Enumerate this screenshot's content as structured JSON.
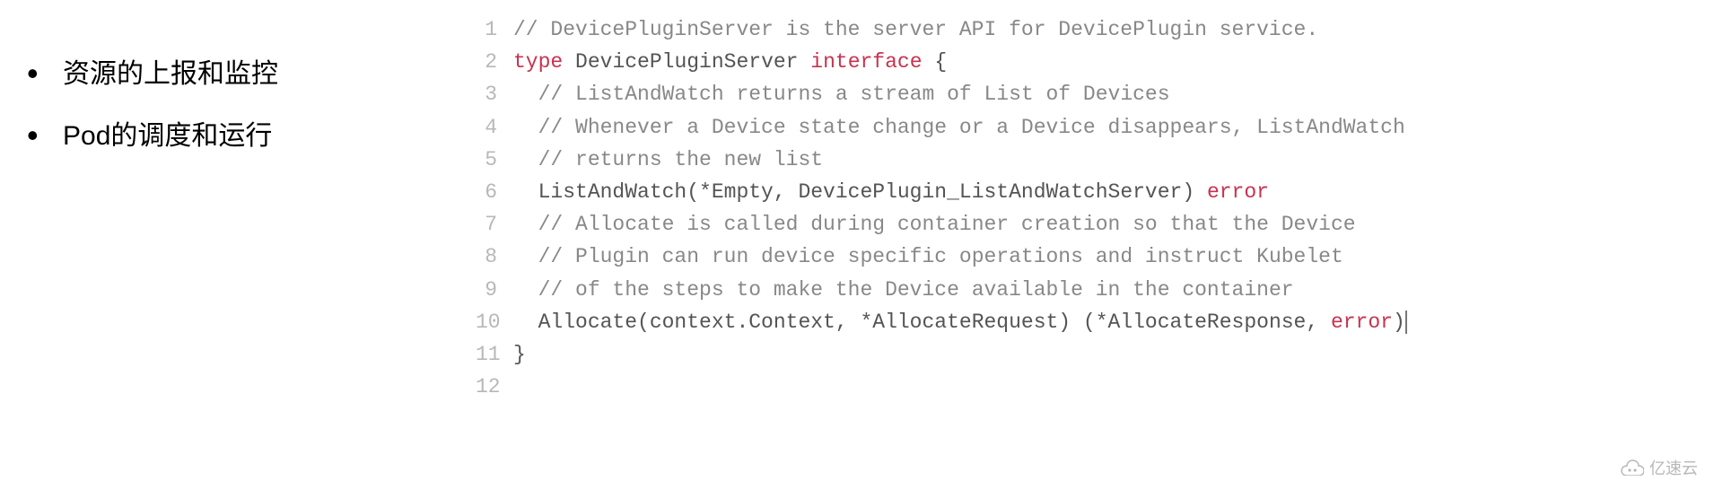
{
  "left": {
    "bullets": [
      "资源的上报和监控",
      "Pod的调度和运行"
    ]
  },
  "code": {
    "lines": [
      {
        "n": "1",
        "segments": [
          {
            "cls": "tok-comment",
            "pad": "",
            "text": "// DevicePluginServer is the server API for DevicePlugin service."
          }
        ]
      },
      {
        "n": "2",
        "segments": [
          {
            "cls": "tok-keyword",
            "pad": "",
            "text": "type"
          },
          {
            "cls": "tok-plain",
            "pad": " ",
            "text": "DevicePluginServer "
          },
          {
            "cls": "tok-keyword",
            "pad": "",
            "text": "interface"
          },
          {
            "cls": "tok-plain",
            "pad": " ",
            "text": "{"
          }
        ]
      },
      {
        "n": "3",
        "segments": [
          {
            "cls": "tok-comment",
            "pad": "  ",
            "text": "// ListAndWatch returns a stream of List of Devices"
          }
        ]
      },
      {
        "n": "4",
        "segments": [
          {
            "cls": "tok-comment",
            "pad": "  ",
            "text": "// Whenever a Device state change or a Device disappears, ListAndWatch"
          }
        ]
      },
      {
        "n": "5",
        "segments": [
          {
            "cls": "tok-comment",
            "pad": "  ",
            "text": "// returns the new list"
          }
        ]
      },
      {
        "n": "6",
        "segments": [
          {
            "cls": "tok-plain",
            "pad": "  ",
            "text": "ListAndWatch(*Empty, DevicePlugin_ListAndWatchServer) "
          },
          {
            "cls": "tok-type",
            "pad": "",
            "text": "error"
          }
        ]
      },
      {
        "n": "7",
        "segments": [
          {
            "cls": "tok-comment",
            "pad": "  ",
            "text": "// Allocate is called during container creation so that the Device"
          }
        ]
      },
      {
        "n": "8",
        "segments": [
          {
            "cls": "tok-comment",
            "pad": "  ",
            "text": "// Plugin can run device specific operations and instruct Kubelet"
          }
        ]
      },
      {
        "n": "9",
        "segments": [
          {
            "cls": "tok-comment",
            "pad": "  ",
            "text": "// of the steps to make the Device available in the container"
          }
        ]
      },
      {
        "n": "10",
        "cursor": true,
        "segments": [
          {
            "cls": "tok-plain",
            "pad": "  ",
            "text": "Allocate(context.Context, *AllocateRequest) (*AllocateResponse, "
          },
          {
            "cls": "tok-type",
            "pad": "",
            "text": "error"
          },
          {
            "cls": "tok-plain",
            "pad": "",
            "text": ")"
          }
        ]
      },
      {
        "n": "11",
        "segments": [
          {
            "cls": "tok-plain",
            "pad": "",
            "text": "}"
          }
        ]
      },
      {
        "n": "12",
        "segments": [
          {
            "cls": "tok-plain",
            "pad": "",
            "text": ""
          }
        ]
      }
    ]
  },
  "watermark": {
    "text": "亿速云"
  }
}
